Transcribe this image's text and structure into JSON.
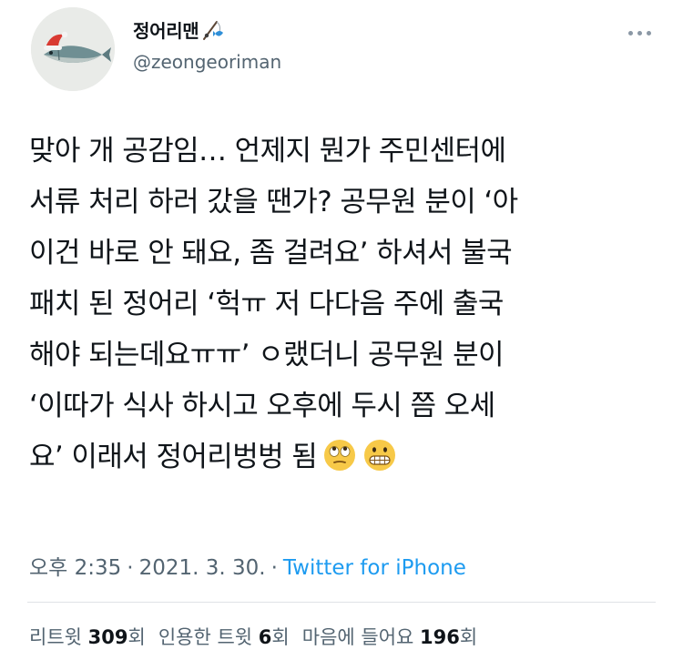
{
  "author": {
    "display_name": "정어리맨",
    "handle": "@zeongeoriman",
    "name_emoji": "fishing-pole-emoji",
    "avatar": "sardine-with-santa-hat-icon"
  },
  "more_icon": "more-dots-icon",
  "tweet": {
    "lines": [
      "맞아 개 공감임… 언제지 뭔가 주민센터에",
      "서류 처리 하러 갔을 땐가? 공무원 분이 ‘아",
      "이건 바로 안 돼요, 좀 걸려요’ 하셔서 불국",
      "패치 된 정어리 ‘헉ㅠ 저 다다음 주에 출국",
      "해야 되는데요ㅠㅠ’ ㅇ랬더니 공무원 분이",
      "‘이따가 식사 하시고 오후에 두시 쯤 오세",
      "요’ 이래서 정어리벙벙 됨"
    ],
    "emojis": [
      "face-with-rolling-eyes-emoji",
      "grimacing-face-emoji"
    ]
  },
  "meta": {
    "time": "오후 2:35",
    "separator": "·",
    "date": "2021. 3. 30.",
    "source": "Twitter for iPhone"
  },
  "stats": {
    "retweets_label": "리트윗",
    "retweets_count": "309",
    "retweets_unit": "회",
    "quotes_label": "인용한 트윗",
    "quotes_count": "6",
    "quotes_unit": "회",
    "likes_label": "마음에 들어요",
    "likes_count": "196",
    "likes_unit": "회"
  },
  "colors": {
    "text": "#0f1419",
    "secondary": "#536471",
    "link": "#1d9bf0",
    "divider": "#dfe3e6"
  }
}
